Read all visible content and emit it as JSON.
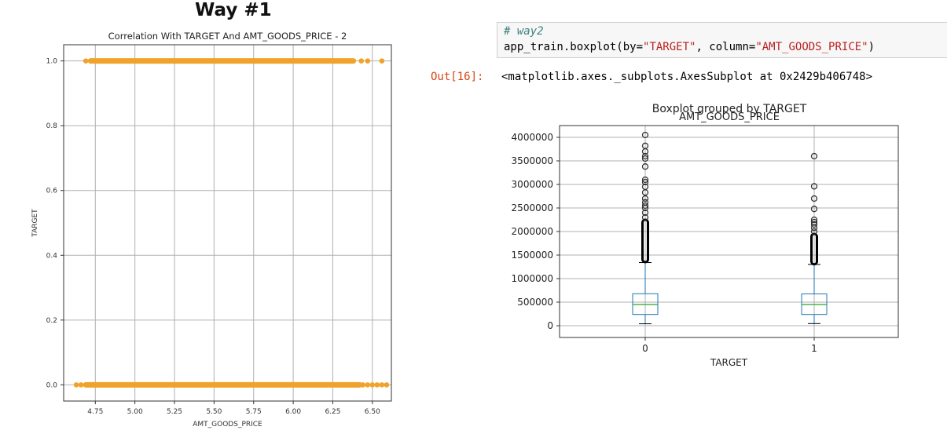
{
  "heading": "Way #1",
  "notebook": {
    "code_comment": "# way2",
    "code_prefix": "app_train.boxplot(by=",
    "code_by": "\"TARGET\"",
    "code_mid": ", column=",
    "code_col": "\"AMT_GOODS_PRICE\"",
    "code_suffix": ")",
    "prompt": "Out[16]:",
    "output": "<matplotlib.axes._subplots.AxesSubplot at 0x2429b406748>"
  },
  "chart_data": [
    {
      "type": "scatter",
      "title": "Correlation With TARGET And AMT_GOODS_PRICE - 2",
      "xlabel": "AMT_GOODS_PRICE",
      "ylabel": "TARGET",
      "xlim": [
        4.55,
        6.62
      ],
      "ylim": [
        -0.05,
        1.05
      ],
      "xticks": [
        "4.75",
        "5.00",
        "5.25",
        "5.50",
        "5.75",
        "6.00",
        "6.25",
        "6.50"
      ],
      "yticks": [
        "0.0",
        "0.2",
        "0.4",
        "0.6",
        "0.8",
        "1.0"
      ],
      "grid": true,
      "color": "#f0a32a",
      "series": [
        {
          "y": 1,
          "x_range": [
            4.72,
            6.38
          ],
          "isolated_x": [
            4.69,
            6.43,
            6.47,
            6.56
          ]
        },
        {
          "y": 0,
          "x_range": [
            4.69,
            6.42
          ],
          "isolated_x": [
            4.63,
            4.66,
            6.44,
            6.47,
            6.5,
            6.53,
            6.56,
            6.59
          ]
        }
      ]
    },
    {
      "type": "box",
      "suptitle": "Boxplot grouped by TARGET",
      "title": "AMT_GOODS_PRICE",
      "xlabel": "TARGET",
      "categories": [
        "0",
        "1"
      ],
      "ylim": [
        -250000,
        4250000
      ],
      "yticks": [
        0,
        500000,
        1000000,
        1500000,
        2000000,
        2500000,
        3000000,
        3500000,
        4000000
      ],
      "grid": true,
      "box_color": "#1f77b4",
      "median_color": "#2ca02c",
      "boxes": [
        {
          "category": "0",
          "whisker_low": 40500,
          "q1": 238500,
          "median": 450000,
          "q3": 679500,
          "whisker_high": 1341000,
          "outlier_dense_range": [
            1350000,
            2250000
          ],
          "outliers": [
            2300000,
            2400000,
            2500000,
            2550000,
            2620000,
            2700000,
            2830000,
            2950000,
            3050000,
            3100000,
            3380000,
            3550000,
            3600000,
            3700000,
            3820000,
            4050000
          ]
        },
        {
          "category": "1",
          "whisker_low": 45000,
          "q1": 238500,
          "median": 450000,
          "q3": 675000,
          "whisker_high": 1300000,
          "outlier_dense_range": [
            1305000,
            1950000
          ],
          "outliers": [
            2000000,
            2080000,
            2150000,
            2200000,
            2250000,
            2480000,
            2700000,
            2960000,
            3600000
          ]
        }
      ]
    }
  ]
}
